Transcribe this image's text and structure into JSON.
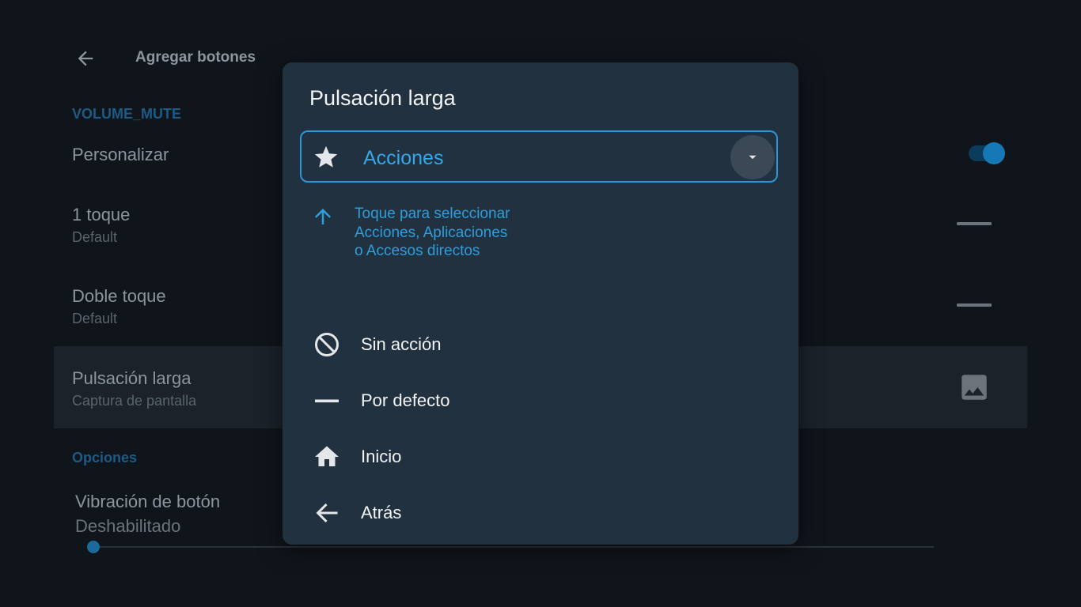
{
  "header": {
    "title": "Agregar botones"
  },
  "background": {
    "section1": "VOLUME_MUTE",
    "customize": "Personalizar",
    "single_tap": {
      "title": "1 toque",
      "value": "Default"
    },
    "double_tap": {
      "title": "Doble toque",
      "value": "Default"
    },
    "long_press": {
      "title": "Pulsación larga",
      "value": "Captura de pantalla"
    },
    "section2": "Opciones",
    "vibration": {
      "title": "Vibración de botón",
      "value": "Deshabilitado"
    }
  },
  "dialog": {
    "title": "Pulsación larga",
    "select": {
      "value": "Acciones",
      "icon": "star-icon"
    },
    "hint": "Toque para seleccionar Acciones, Aplicaciones o Accesos directos",
    "options": [
      {
        "label": "Sin acción",
        "icon": "block-icon"
      },
      {
        "label": "Por defecto",
        "icon": "minus-icon"
      },
      {
        "label": "Inicio",
        "icon": "home-icon"
      },
      {
        "label": "Atrás",
        "icon": "arrow-left-icon"
      }
    ]
  },
  "colors": {
    "accent": "#2d9edc",
    "dialog_bg": "#223140",
    "page_bg": "#10151b"
  }
}
